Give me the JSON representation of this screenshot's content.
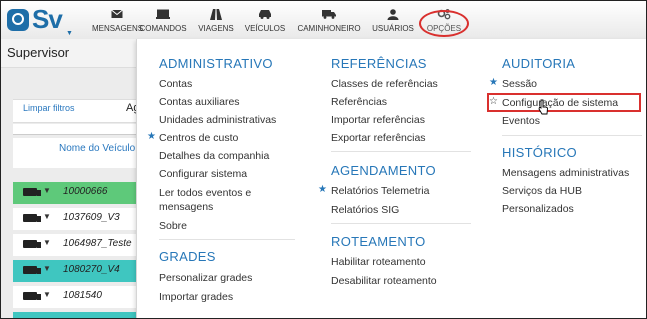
{
  "logo": {
    "text": "Sv",
    "caret": "▼"
  },
  "nav": [
    {
      "label": "MENSAGENS",
      "icon": "envelope-icon"
    },
    {
      "label": "COMANDOS",
      "icon": "monitor-icon"
    },
    {
      "label": "VIAGENS",
      "icon": "road-icon"
    },
    {
      "label": "VEÍCULOS",
      "icon": "car-icon"
    },
    {
      "label": "CAMINHONEIRO",
      "icon": "truck-icon"
    },
    {
      "label": "USUÁRIOS",
      "icon": "user-icon"
    },
    {
      "label": "OPÇÕES",
      "icon": "gears-icon"
    }
  ],
  "page": {
    "title": "Supervisor",
    "clear_filters": "Limpar filtros",
    "partial_label": "Ag",
    "column_header": "Nome do Veículo",
    "rows": [
      {
        "id": "10000666",
        "color": "#5ec97a"
      },
      {
        "id": "1037609_V3",
        "color": "#ffffff"
      },
      {
        "id": "1064987_Teste",
        "color": "#ffffff"
      },
      {
        "id": "1080270_V4",
        "color": "#3fc6c0"
      },
      {
        "id": "1081540",
        "color": "#ffffff"
      },
      {
        "id": "",
        "color": "#3fc6c0"
      }
    ]
  },
  "menu": {
    "col1": {
      "administrativo": {
        "title": "ADMINISTRATIVO",
        "items": [
          "Contas",
          "Contas auxiliares",
          "Unidades administrativas",
          "Centros de custo",
          "Detalhes da companhia",
          "Configurar sistema",
          "Ler todos eventos e mensagens",
          "Sobre"
        ]
      },
      "grades": {
        "title": "GRADES",
        "items": [
          "Personalizar grades",
          "Importar grades"
        ]
      }
    },
    "col2": {
      "referencias": {
        "title": "REFERÊNCIAS",
        "items": [
          "Classes de referências",
          "Referências",
          "Importar referências",
          "Exportar referências"
        ]
      },
      "agendamento": {
        "title": "AGENDAMENTO",
        "items": [
          "Relatórios Telemetria",
          "Relatórios SIG"
        ]
      },
      "roteamento": {
        "title": "ROTEAMENTO",
        "items": [
          "Habilitar roteamento",
          "Desabilitar roteamento"
        ]
      }
    },
    "col3": {
      "auditoria": {
        "title": "AUDITORIA",
        "items": [
          "Sessão",
          "Configuração de sistema",
          "Eventos"
        ]
      },
      "historico": {
        "title": "HISTÓRICO",
        "items": [
          "Mensagens administrativas",
          "Serviços da HUB",
          "Personalizados"
        ]
      }
    }
  },
  "colors": {
    "accent": "#2777b8",
    "highlight": "#d9302e"
  }
}
